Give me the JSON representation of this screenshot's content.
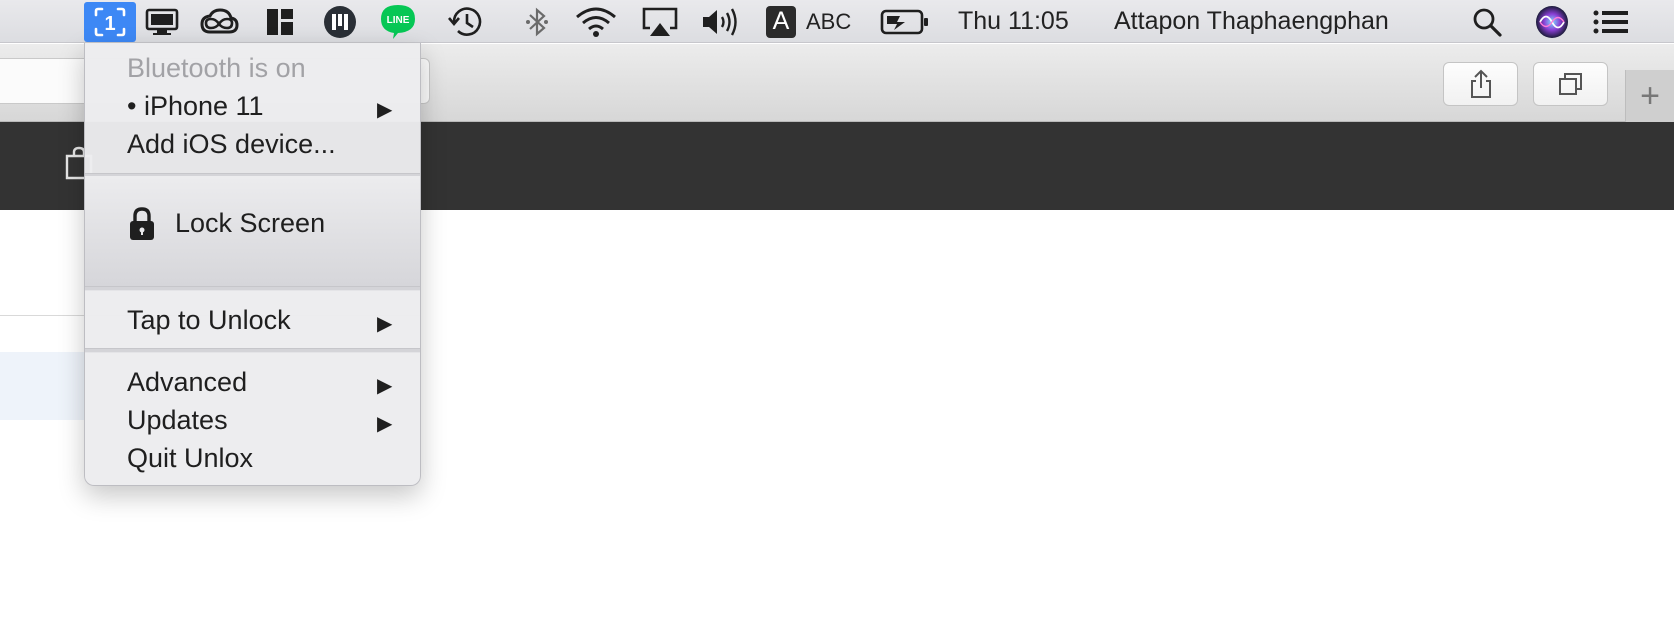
{
  "menubar": {
    "clock": "Thu 11:05",
    "user": "Attapon Thaphaengphan",
    "input_source_letter": "A",
    "input_source_label": "ABC",
    "line_label": "LINE",
    "unlox_glyph": "1",
    "icons": [
      "unlox-icon",
      "display-icon",
      "creative-cloud-icon",
      "magnet-icon",
      "meister-icon",
      "line-icon",
      "time-machine-icon",
      "bluetooth-icon",
      "wifi-icon",
      "airplay-icon",
      "volume-icon",
      "input-source-icon",
      "battery-icon",
      "spotlight-icon",
      "siri-icon",
      "notification-center-icon"
    ]
  },
  "menu": {
    "bluetooth_status": "Bluetooth is on",
    "device": "• iPhone 11",
    "add_device": "Add iOS device...",
    "lock_screen": "Lock Screen",
    "tap_to_unlock": "Tap to Unlock",
    "advanced": "Advanced",
    "updates": "Updates",
    "quit": "Quit Unlox",
    "submenu_arrow": "▶"
  },
  "toolbar": {
    "new_tab": "+"
  },
  "colors": {
    "accent": "#3d88f5",
    "menubar": "#e4e4e8",
    "dark_header": "#333333",
    "line_green": "#06c755"
  }
}
